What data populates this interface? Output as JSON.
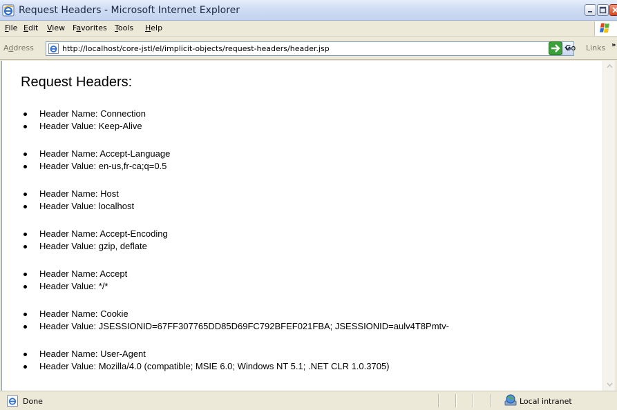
{
  "window": {
    "title": "Request Headers - Microsoft Internet Explorer"
  },
  "menu": {
    "items": [
      {
        "underline": "F",
        "rest": "ile"
      },
      {
        "underline": "E",
        "rest": "dit"
      },
      {
        "underline": "V",
        "rest": "iew"
      },
      {
        "pre": "F",
        "underline": "a",
        "rest": "vorites"
      },
      {
        "underline": "T",
        "rest": "ools"
      },
      {
        "underline": "H",
        "rest": "elp"
      }
    ]
  },
  "address": {
    "label_pre": "A",
    "label_u": "d",
    "label_rest": "dress",
    "url": "http://localhost/core-jstl/el/implicit-objects/request-headers/header.jsp",
    "go_label": "Go",
    "links_label": "Links"
  },
  "page": {
    "heading": "Request Headers:",
    "headers": [
      {
        "name": "Header Name: Connection",
        "value": "Header Value: Keep-Alive"
      },
      {
        "name": "Header Name: Accept-Language",
        "value": "Header Value: en-us,fr-ca;q=0.5"
      },
      {
        "name": "Header Name: Host",
        "value": "Header Value: localhost"
      },
      {
        "name": "Header Name: Accept-Encoding",
        "value": "Header Value: gzip, deflate"
      },
      {
        "name": "Header Name: Accept",
        "value": "Header Value: */*"
      },
      {
        "name": "Header Name: Cookie",
        "value": "Header Value: JSESSIONID=67FF307765DD85D69FC792BFEF021FBA; JSESSIONID=aulv4T8Pmtv-"
      },
      {
        "name": "Header Name: User-Agent",
        "value": "Header Value: Mozilla/4.0 (compatible; MSIE 6.0; Windows NT 5.1; .NET CLR 1.0.3705)"
      }
    ]
  },
  "status": {
    "text": "Done",
    "zone": "Local intranet"
  },
  "icons": {
    "title": "ie-icon",
    "address": "ie-page-icon",
    "go": "go-arrow-icon",
    "status": "ie-page-icon",
    "zone": "globe-icon",
    "throbber": "windows-flag-icon"
  },
  "colors": {
    "titlebar": "#cfdcf3",
    "chrome": "#ece9d8",
    "close": "#d6441f",
    "go": "#3aa13a"
  }
}
